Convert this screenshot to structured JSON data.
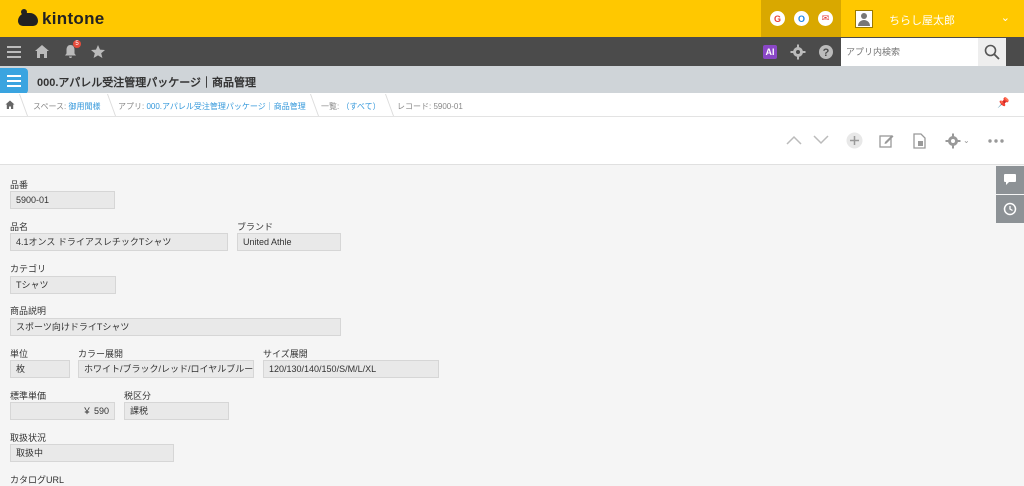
{
  "header": {
    "brand": "kintone",
    "icons": [
      {
        "name": "G",
        "color": "#ea4335"
      },
      {
        "name": "O",
        "color": "#1e88e5"
      },
      {
        "name": "✉",
        "color": "#e53935"
      }
    ],
    "user_name": "ちらし屋太郎"
  },
  "navbar": {
    "notification_count": "5",
    "ai_label": "AI",
    "search_placeholder": "アプリ内検索"
  },
  "app": {
    "title": "000.アパレル受注管理パッケージ｜商品管理"
  },
  "breadcrumb": {
    "space_prefix": "スペース: ",
    "space": "御用聞様",
    "app_prefix": "アプリ: ",
    "app": "000.アパレル受注管理パッケージ｜商品管理",
    "view_prefix": "一覧: ",
    "view": "（すべて）",
    "record": "レコード: 5900-01"
  },
  "form": {
    "fields": {
      "hinban": {
        "label": "品番",
        "value": "5900-01"
      },
      "hinmei": {
        "label": "品名",
        "value": "4.1オンス ドライアスレチックTシャツ"
      },
      "brand": {
        "label": "ブランド",
        "value": "United Athle"
      },
      "category": {
        "label": "カテゴリ",
        "value": "Tシャツ"
      },
      "description": {
        "label": "商品説明",
        "value": "スポーツ向けドライTシャツ"
      },
      "unit": {
        "label": "単位",
        "value": "枚"
      },
      "colors": {
        "label": "カラー展開",
        "value": "ホワイト/ブラック/レッド/ロイヤルブルー"
      },
      "sizes": {
        "label": "サイズ展開",
        "value": "120/130/140/150/S/M/L/XL"
      },
      "price": {
        "label": "標準単価",
        "value": "￥ 590"
      },
      "tax": {
        "label": "税区分",
        "value": "課税"
      },
      "status": {
        "label": "取扱状況",
        "value": "取扱中"
      },
      "catalog": {
        "label": "カタログURL"
      }
    }
  }
}
